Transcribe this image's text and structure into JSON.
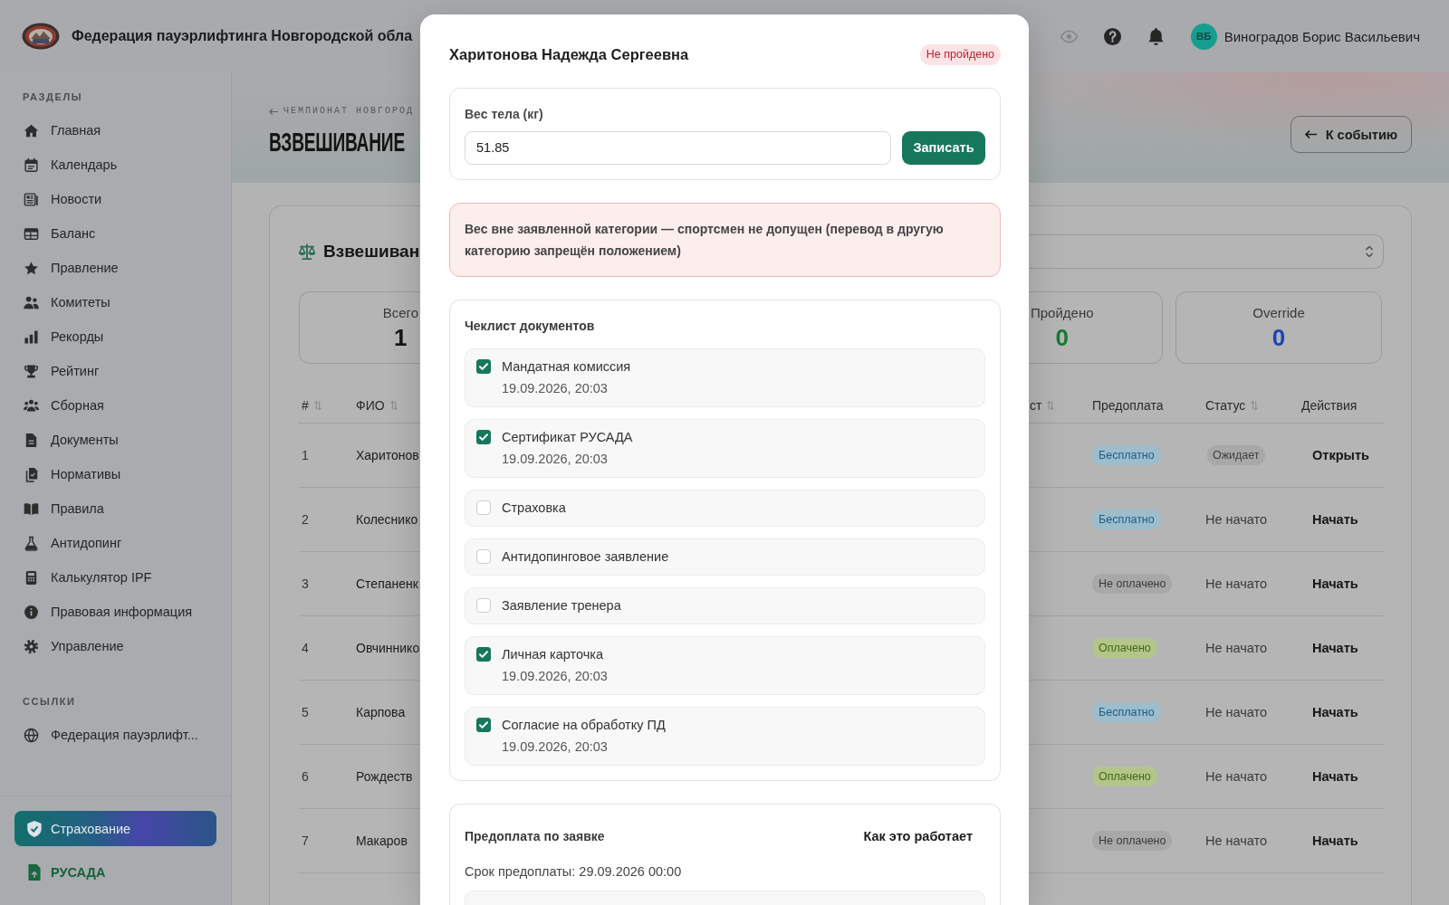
{
  "header": {
    "title": "Федерация пауэрлифтинга Новгородской обла",
    "user": {
      "initials": "ВБ",
      "name": "Виноградов Борис Васильевич"
    }
  },
  "sidebar": {
    "sections": [
      {
        "title": "РАЗДЕЛЫ",
        "items": [
          {
            "label": "Главная"
          },
          {
            "label": "Календарь"
          },
          {
            "label": "Новости"
          },
          {
            "label": "Баланс"
          },
          {
            "label": "Правление"
          },
          {
            "label": "Комитеты"
          },
          {
            "label": "Рекорды"
          },
          {
            "label": "Рейтинг"
          },
          {
            "label": "Сборная"
          },
          {
            "label": "Документы"
          },
          {
            "label": "Нормативы"
          },
          {
            "label": "Правила"
          },
          {
            "label": "Антидопинг"
          },
          {
            "label": "Калькулятор IPF"
          },
          {
            "label": "Правовая информация"
          },
          {
            "label": "Управление"
          }
        ]
      },
      {
        "title": "ССЫЛКИ",
        "items": [
          {
            "label": "Федерация пауэрлифт..."
          }
        ]
      }
    ],
    "footer": [
      {
        "label": "Страхование",
        "kind": "promo"
      },
      {
        "label": "РУСАДА",
        "kind": "link"
      }
    ]
  },
  "page": {
    "breadcrumb": "ЧЕМПИОНАТ НОВГОРОД",
    "title": "ВЗВЕШИВАНИЕ",
    "back_button": "К событию"
  },
  "weighin": {
    "title": "Взвешиван",
    "stats": [
      {
        "label": "Всего",
        "value": "1",
        "kind": "total"
      },
      {
        "label": "Пройдено",
        "value": "0",
        "kind": "passed"
      },
      {
        "label": "Override",
        "value": "0",
        "kind": "override"
      }
    ],
    "table": {
      "columns": [
        {
          "label": "#",
          "sortable": true
        },
        {
          "label": "ФИО",
          "sortable": true
        },
        {
          "label": "ст",
          "sortable": true
        },
        {
          "label": "Предоплата",
          "sortable": false
        },
        {
          "label": "Статус",
          "sortable": true
        },
        {
          "label": "Действия",
          "sortable": false
        }
      ],
      "rows": [
        {
          "number": "1",
          "name": "Харитонов",
          "payment": {
            "label": "Бесплатно",
            "kind": "free"
          },
          "status": {
            "label": "Ожидает",
            "kind": "waiting"
          },
          "action": "Открыть"
        },
        {
          "number": "2",
          "name": "Колеснико",
          "payment": {
            "label": "Бесплатно",
            "kind": "free"
          },
          "status": {
            "label": "Не начато",
            "kind": "not_started"
          },
          "action": "Начать"
        },
        {
          "number": "3",
          "name": "Степаненк",
          "payment": {
            "label": "Не оплачено",
            "kind": "unpaid"
          },
          "status": {
            "label": "Не начато",
            "kind": "not_started"
          },
          "action": "Начать"
        },
        {
          "number": "4",
          "name": "Овчиннико",
          "payment": {
            "label": "Оплачено",
            "kind": "paid"
          },
          "status": {
            "label": "Не начато",
            "kind": "not_started"
          },
          "action": "Начать"
        },
        {
          "number": "5",
          "name": "Карпова",
          "payment": {
            "label": "Бесплатно",
            "kind": "free"
          },
          "status": {
            "label": "Не начато",
            "kind": "not_started"
          },
          "action": "Начать"
        },
        {
          "number": "6",
          "name": "Рождеств",
          "payment": {
            "label": "Оплачено",
            "kind": "paid"
          },
          "status": {
            "label": "Не начато",
            "kind": "not_started"
          },
          "action": "Начать"
        },
        {
          "number": "7",
          "name": "Макаров",
          "payment": {
            "label": "Не оплачено",
            "kind": "unpaid"
          },
          "status": {
            "label": "Не начато",
            "kind": "not_started"
          },
          "action": "Начать"
        }
      ]
    }
  },
  "modal": {
    "title": "Харитонова Надежда Сергеевна",
    "status": {
      "label": "Не пройдено",
      "kind": "failed"
    },
    "weight": {
      "label": "Вес тела (кг)",
      "value": "51.85",
      "button": "Записать"
    },
    "alert": {
      "text": "Вес вне заявленной категории — спортсмен не допущен (перевод в другую категорию запрещён положением)",
      "kind": "error"
    },
    "checklist": {
      "title": "Чеклист документов",
      "items": [
        {
          "label": "Мандатная комиссия",
          "checked": true,
          "date": "19.09.2026, 20:03"
        },
        {
          "label": "Сертификат РУСАДА",
          "checked": true,
          "date": "19.09.2026, 20:03"
        },
        {
          "label": "Страховка",
          "checked": false
        },
        {
          "label": "Антидопинговое заявление",
          "checked": false
        },
        {
          "label": "Заявление тренера",
          "checked": false
        },
        {
          "label": "Личная карточка",
          "checked": true,
          "date": "19.09.2026, 20:03"
        },
        {
          "label": "Согласие на обработку ПД",
          "checked": true,
          "date": "19.09.2026, 20:03"
        }
      ]
    },
    "prepayment": {
      "title": "Предоплата по заявке",
      "help_link": "Как это работает",
      "deadline": "Срок предоплаты: 29.09.2026 00:00"
    }
  }
}
